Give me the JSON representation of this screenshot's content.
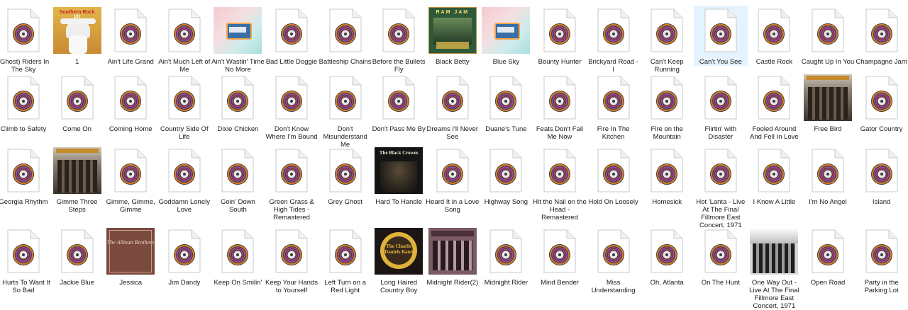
{
  "rows": [
    [
      {
        "label": "(Ghost) Riders In The Sky",
        "type": "audio"
      },
      {
        "label": "1",
        "type": "art",
        "art": "southern-rock",
        "art_text": "Southern Rock",
        "art_sub": "101"
      },
      {
        "label": "Ain't Life Grand",
        "type": "audio"
      },
      {
        "label": "Ain't Much Left of Me",
        "type": "audio"
      },
      {
        "label": "Ain't Wastin' Time No More",
        "type": "art",
        "art": "peach"
      },
      {
        "label": "Bad Little Doggie",
        "type": "audio"
      },
      {
        "label": "Battleship Chains",
        "type": "audio"
      },
      {
        "label": "Before the Bullets Fly",
        "type": "audio"
      },
      {
        "label": "Black Betty",
        "type": "art",
        "art": "ramjam",
        "art_text": "RAM JAM"
      },
      {
        "label": "Blue Sky",
        "type": "art",
        "art": "peach"
      },
      {
        "label": "Bounty Hunter",
        "type": "audio"
      },
      {
        "label": "Brickyard Road - I",
        "type": "audio"
      },
      {
        "label": "Can't Keep Running",
        "type": "audio"
      },
      {
        "label": "Can't You See",
        "type": "audio",
        "selected": true
      },
      {
        "label": "Castle Rock",
        "type": "audio"
      },
      {
        "label": "Caught Up In You",
        "type": "audio"
      },
      {
        "label": "Champagne Jam",
        "type": "audio"
      }
    ],
    [
      {
        "label": "Climb to Safety",
        "type": "audio"
      },
      {
        "label": "Come On",
        "type": "audio"
      },
      {
        "label": "Coming Home",
        "type": "audio"
      },
      {
        "label": "Country Side Of Life",
        "type": "audio"
      },
      {
        "label": "Dixie Chicken",
        "type": "audio"
      },
      {
        "label": "Don't Know Where I'm Bound",
        "type": "audio"
      },
      {
        "label": "Don't Misunderstand Me",
        "type": "audio"
      },
      {
        "label": "Don't Pass Me By",
        "type": "audio"
      },
      {
        "label": "Dreams I'll Never See",
        "type": "audio"
      },
      {
        "label": "Duane's Tune",
        "type": "audio"
      },
      {
        "label": "Feats Don't Fail Me Now",
        "type": "audio"
      },
      {
        "label": "Fire In The Kitchen",
        "type": "audio"
      },
      {
        "label": "Fire on the Mountain",
        "type": "audio"
      },
      {
        "label": "Flirtin' with Disaster",
        "type": "audio"
      },
      {
        "label": "Fooled Around And Fell In Love",
        "type": "audio"
      },
      {
        "label": "Free Bird",
        "type": "art",
        "art": "skynyrd"
      },
      {
        "label": "Gator Country",
        "type": "audio"
      }
    ],
    [
      {
        "label": "Georgia Rhythm",
        "type": "audio"
      },
      {
        "label": "Gimme Three Steps",
        "type": "art",
        "art": "skynyrd"
      },
      {
        "label": "Gimme, Gimme, Gimme",
        "type": "audio"
      },
      {
        "label": "Goddamn Lonely Love",
        "type": "audio"
      },
      {
        "label": "Goin' Down South",
        "type": "audio"
      },
      {
        "label": "Green Grass & High Tides - Remastered",
        "type": "audio"
      },
      {
        "label": "Grey Ghost",
        "type": "audio"
      },
      {
        "label": "Hard To Handle",
        "type": "art",
        "art": "crowes",
        "art_text": "The Black Crowes"
      },
      {
        "label": "Heard It in a Love Song",
        "type": "audio"
      },
      {
        "label": "Highway Song",
        "type": "audio"
      },
      {
        "label": "Hit the Nail on the Head - Remastered",
        "type": "audio"
      },
      {
        "label": "Hold On Loosely",
        "type": "audio"
      },
      {
        "label": "Homesick",
        "type": "audio"
      },
      {
        "label": "Hot 'Lanta - Live At The Final Fillmore East Concert, 1971",
        "type": "audio"
      },
      {
        "label": "I Know A Little",
        "type": "audio"
      },
      {
        "label": "I'm No Angel",
        "type": "audio"
      },
      {
        "label": "Island",
        "type": "audio"
      }
    ],
    [
      {
        "label": "It Hurts To Want It So Bad",
        "type": "audio"
      },
      {
        "label": "Jackie Blue",
        "type": "audio"
      },
      {
        "label": "Jessica",
        "type": "art",
        "art": "allman",
        "art_text": "The Allman Brothers"
      },
      {
        "label": "Jim Dandy",
        "type": "audio"
      },
      {
        "label": "Keep On Smilin'",
        "type": "audio"
      },
      {
        "label": "Keep Your Hands to Yourself",
        "type": "audio"
      },
      {
        "label": "Left Turn on a Red Light",
        "type": "audio"
      },
      {
        "label": "Long Haired Country Boy",
        "type": "art",
        "art": "cdb",
        "art_text": "The Charlie Daniels Band"
      },
      {
        "label": "Midnight Rider(2)",
        "type": "art",
        "art": "midnight"
      },
      {
        "label": "Midnight Rider",
        "type": "audio"
      },
      {
        "label": "Mind Bender",
        "type": "audio"
      },
      {
        "label": "Miss Understanding",
        "type": "audio"
      },
      {
        "label": "Oh, Atlanta",
        "type": "audio"
      },
      {
        "label": "On The Hunt",
        "type": "audio"
      },
      {
        "label": "One Way Out - Live At The Final Fillmore East Concert, 1971",
        "type": "art",
        "art": "fillmore"
      },
      {
        "label": "Open Road",
        "type": "audio"
      },
      {
        "label": "Party in the Parking Lot",
        "type": "audio"
      }
    ]
  ]
}
